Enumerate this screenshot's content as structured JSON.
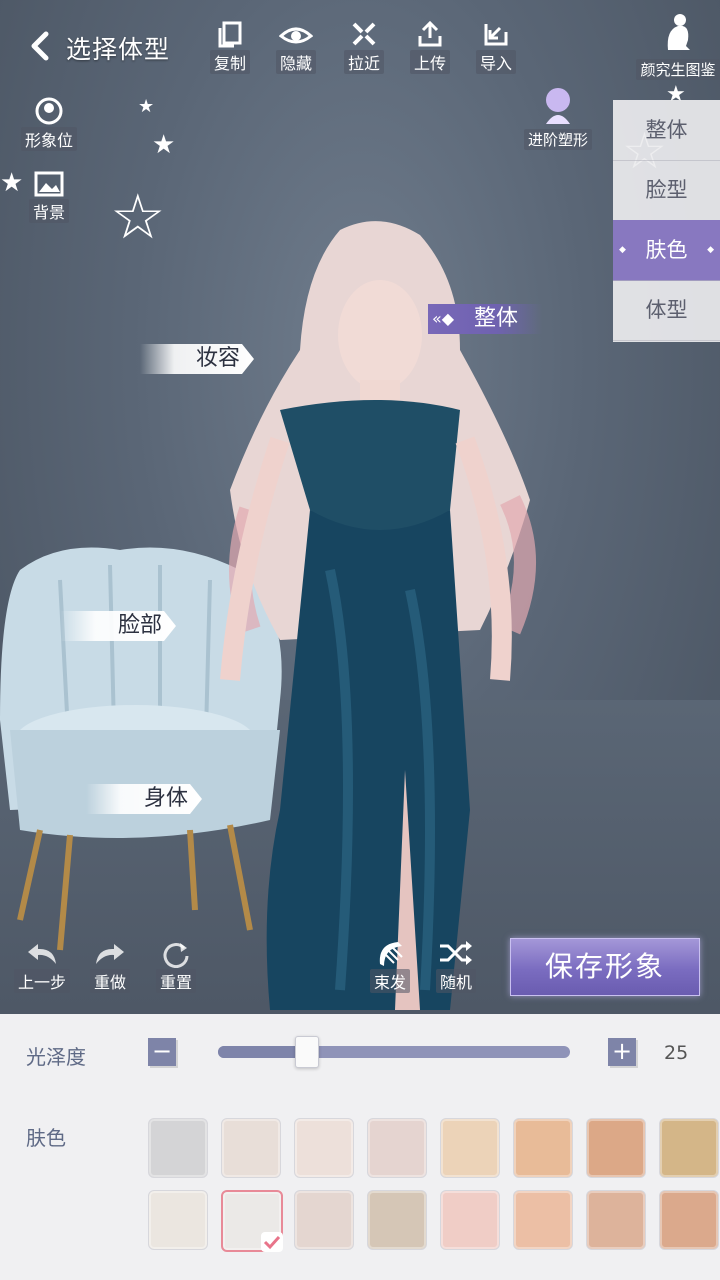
{
  "header": {
    "title": "选择体型",
    "tools": [
      {
        "label": "复制",
        "icon": "copy-icon"
      },
      {
        "label": "隐藏",
        "icon": "eye-icon"
      },
      {
        "label": "拉近",
        "icon": "zoom-in-icon"
      },
      {
        "label": "上传",
        "icon": "upload-icon"
      },
      {
        "label": "导入",
        "icon": "import-icon"
      }
    ],
    "gallery_label": "颜究生图鉴",
    "advanced_label": "进阶塑形"
  },
  "side_tools": [
    {
      "label": "形象位",
      "icon": "figure-slot-icon"
    },
    {
      "label": "背景",
      "icon": "image-icon"
    }
  ],
  "categories": {
    "items": [
      "整体",
      "脸型",
      "肤色",
      "体型"
    ],
    "active_index": 2
  },
  "body_tags": {
    "makeup": "妆容",
    "whole": "整体",
    "face": "脸部",
    "body": "身体"
  },
  "bottom_tools": [
    {
      "label": "上一步",
      "icon": "undo-icon"
    },
    {
      "label": "重做",
      "icon": "redo-icon"
    },
    {
      "label": "重置",
      "icon": "reset-icon"
    },
    {
      "label": "束发",
      "icon": "comb-icon"
    },
    {
      "label": "随机",
      "icon": "shuffle-icon"
    }
  ],
  "save_label": "保存形象",
  "gloss": {
    "label": "光泽度",
    "minus": "−",
    "plus": "+",
    "value": 25,
    "value_text": "25",
    "max": 100
  },
  "skin": {
    "label": "肤色",
    "row1": [
      "#d4d4d6",
      "#e8ded8",
      "#ede0da",
      "#e5d4d0",
      "#ecd3b8",
      "#e8bb98",
      "#dca887",
      "#d4b688"
    ],
    "row2": [
      "#ebe6e0",
      "#ebe9e7",
      "#e4d6d0",
      "#d5c6b6",
      "#f0cdc6",
      "#ecbfa5",
      "#ddb39b",
      "#dba98c"
    ],
    "selected_row": 2,
    "selected_index": 1
  },
  "colors": {
    "accent": "#7a6cc0",
    "slider": "#8f93b8"
  }
}
